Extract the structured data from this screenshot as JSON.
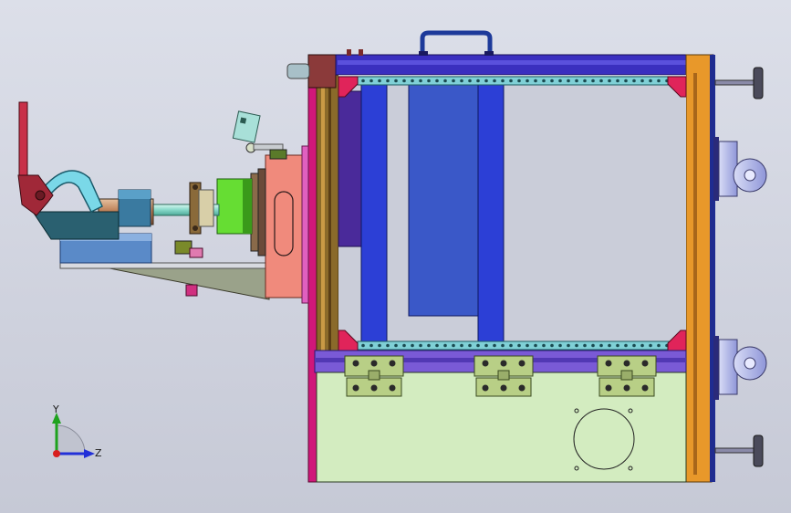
{
  "view": {
    "background": "#cfd2de",
    "axis_triad": {
      "y_label": "Y",
      "z_label": "Z"
    }
  },
  "colors": {
    "frame_top": "#3a2fbf",
    "frame_left_magenta": "#d0177a",
    "frame_right_orange": "#e8982a",
    "panel_blue": "#2c3fd6",
    "panel_navy": "#3a58c8",
    "rail_teal": "#7fd0d6",
    "bottom_panel": "#d3ecc0",
    "hinge": "#b8cf86",
    "corner_bracket": "#e0245a",
    "cylinder_green": "#66dd33",
    "handle_red": "#a02838",
    "plate_salmon": "#f08a7c"
  },
  "parts": {
    "frame": "frame-assembly",
    "clamp": "toggle-clamp",
    "casters": [
      "caster-upper",
      "caster-lower"
    ],
    "feet": [
      "leveling-foot-top",
      "leveling-foot-bottom"
    ],
    "hinges": [
      "hinge-left",
      "hinge-middle",
      "hinge-right"
    ]
  }
}
